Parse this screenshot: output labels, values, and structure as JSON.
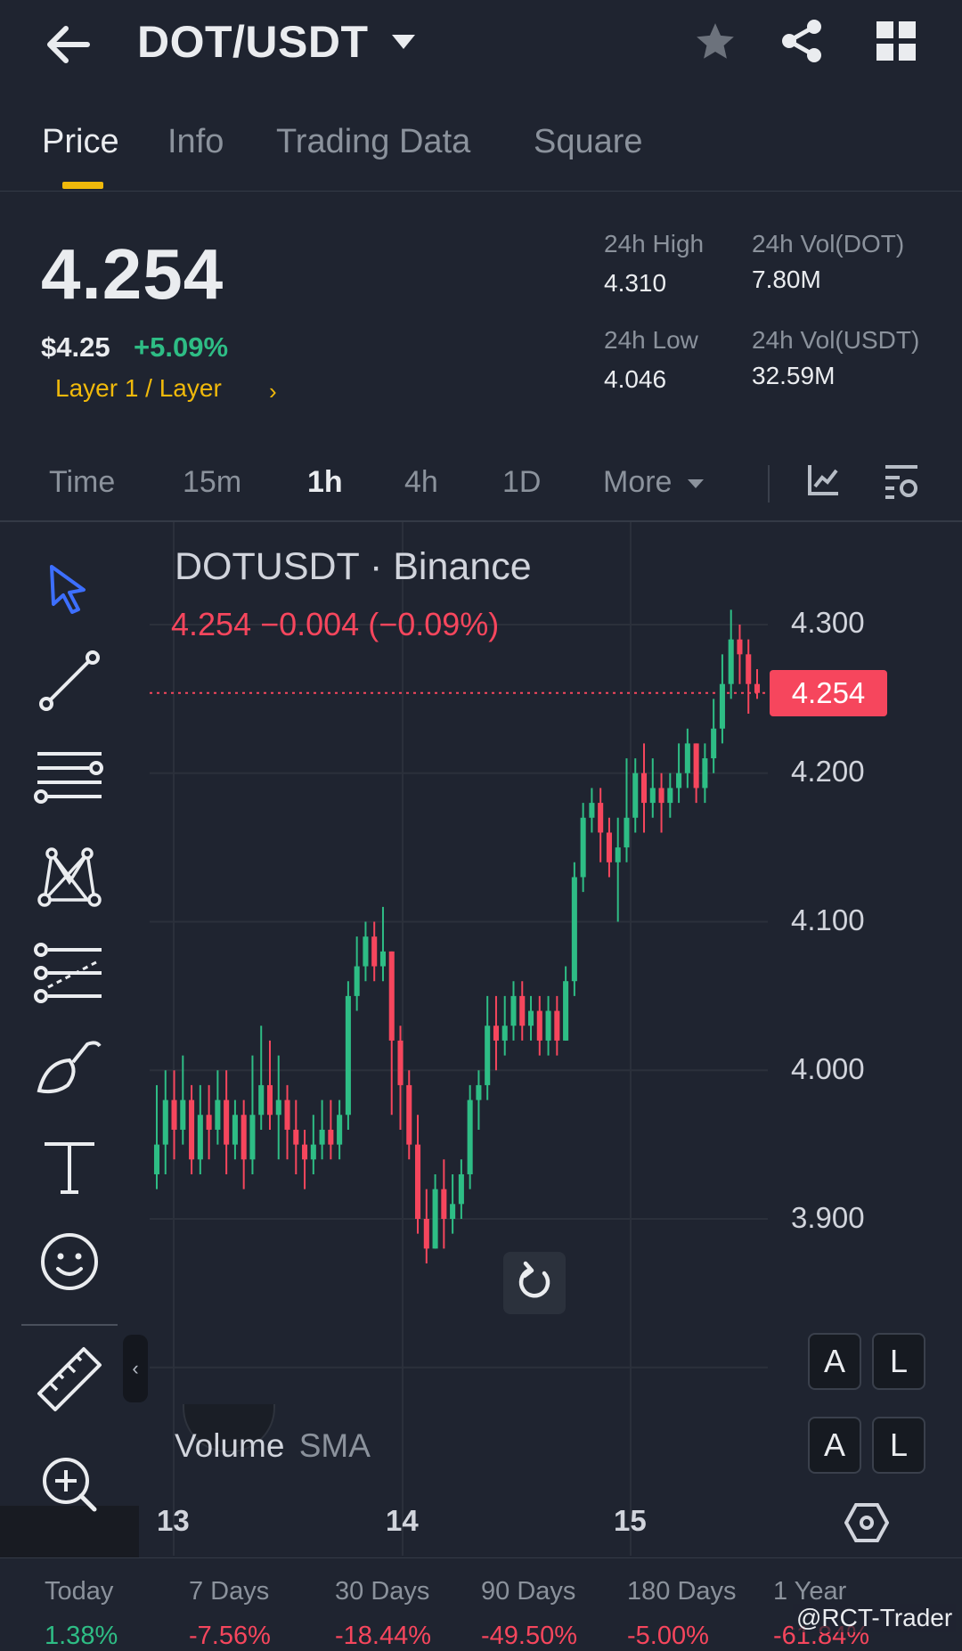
{
  "header": {
    "pair": "DOT/USDT"
  },
  "tabs": [
    "Price",
    "Info",
    "Trading Data",
    "Square"
  ],
  "price": {
    "last": "4.254",
    "usd": "$4.25",
    "change_pct": "+5.09%",
    "tag": "Layer 1 / Layer"
  },
  "stats": {
    "high_label": "24h High",
    "high_value": "4.310",
    "low_label": "24h Low",
    "low_value": "4.046",
    "vol_dot_label": "24h Vol(DOT)",
    "vol_dot_value": "7.80M",
    "vol_usdt_label": "24h Vol(USDT)",
    "vol_usdt_value": "32.59M"
  },
  "intervals": [
    "Time",
    "15m",
    "1h",
    "4h",
    "1D",
    "More"
  ],
  "active_interval": "1h",
  "chart": {
    "title": "DOTUSDT · Binance",
    "ohlc_line": "4.254  −0.004 (−0.09%)",
    "last_price_badge": "4.254",
    "volume_label": "Volume",
    "volume_indicator": "SMA",
    "auto_label": "A",
    "log_label": "L"
  },
  "colors": {
    "up": "#2ebd85",
    "down": "#f6465d",
    "accent": "#f0b90b",
    "background": "#1f2430"
  },
  "chart_data": {
    "type": "candlestick",
    "x_ticks": [
      "13",
      "14",
      "15"
    ],
    "y_ticks": [
      "4.300",
      "4.200",
      "4.100",
      "4.000",
      "3.900"
    ],
    "ylim": [
      3.86,
      4.32
    ],
    "last_price": 4.254,
    "candles": [
      [
        3.93,
        3.95,
        3.92,
        3.99
      ],
      [
        3.95,
        3.98,
        3.93,
        4.0
      ],
      [
        3.98,
        3.96,
        3.94,
        4.0
      ],
      [
        3.96,
        3.98,
        3.95,
        4.01
      ],
      [
        3.98,
        3.94,
        3.93,
        3.99
      ],
      [
        3.94,
        3.97,
        3.93,
        3.99
      ],
      [
        3.97,
        3.96,
        3.94,
        3.99
      ],
      [
        3.96,
        3.98,
        3.95,
        4.0
      ],
      [
        3.98,
        3.95,
        3.93,
        4.0
      ],
      [
        3.95,
        3.97,
        3.94,
        3.98
      ],
      [
        3.97,
        3.94,
        3.92,
        3.98
      ],
      [
        3.94,
        3.97,
        3.93,
        4.01
      ],
      [
        3.97,
        3.99,
        3.96,
        4.03
      ],
      [
        3.99,
        3.97,
        3.96,
        4.02
      ],
      [
        3.97,
        3.98,
        3.94,
        4.01
      ],
      [
        3.98,
        3.96,
        3.94,
        3.99
      ],
      [
        3.96,
        3.95,
        3.93,
        3.98
      ],
      [
        3.95,
        3.94,
        3.92,
        3.96
      ],
      [
        3.94,
        3.95,
        3.93,
        3.97
      ],
      [
        3.95,
        3.96,
        3.94,
        3.98
      ],
      [
        3.96,
        3.95,
        3.94,
        3.98
      ],
      [
        3.95,
        3.97,
        3.94,
        3.98
      ],
      [
        3.97,
        4.05,
        3.96,
        4.06
      ],
      [
        4.05,
        4.07,
        4.04,
        4.09
      ],
      [
        4.07,
        4.09,
        4.06,
        4.1
      ],
      [
        4.09,
        4.07,
        4.06,
        4.1
      ],
      [
        4.07,
        4.08,
        4.06,
        4.11
      ],
      [
        4.08,
        4.02,
        3.97,
        4.08
      ],
      [
        4.02,
        3.99,
        3.96,
        4.03
      ],
      [
        3.99,
        3.95,
        3.94,
        4.0
      ],
      [
        3.95,
        3.9,
        3.89,
        3.97
      ],
      [
        3.9,
        3.88,
        3.87,
        3.92
      ],
      [
        3.88,
        3.92,
        3.88,
        3.93
      ],
      [
        3.92,
        3.9,
        3.88,
        3.94
      ],
      [
        3.9,
        3.91,
        3.89,
        3.93
      ],
      [
        3.91,
        3.93,
        3.9,
        3.94
      ],
      [
        3.93,
        3.98,
        3.92,
        3.99
      ],
      [
        3.98,
        3.99,
        3.96,
        4.0
      ],
      [
        3.99,
        4.03,
        3.98,
        4.05
      ],
      [
        4.03,
        4.02,
        4.0,
        4.05
      ],
      [
        4.02,
        4.03,
        4.01,
        4.05
      ],
      [
        4.03,
        4.05,
        4.02,
        4.06
      ],
      [
        4.05,
        4.03,
        4.02,
        4.06
      ],
      [
        4.03,
        4.04,
        4.02,
        4.05
      ],
      [
        4.04,
        4.02,
        4.01,
        4.05
      ],
      [
        4.02,
        4.04,
        4.01,
        4.05
      ],
      [
        4.04,
        4.02,
        4.01,
        4.05
      ],
      [
        4.02,
        4.06,
        4.02,
        4.07
      ],
      [
        4.06,
        4.13,
        4.05,
        4.14
      ],
      [
        4.13,
        4.17,
        4.12,
        4.18
      ],
      [
        4.17,
        4.18,
        4.16,
        4.19
      ],
      [
        4.18,
        4.16,
        4.14,
        4.19
      ],
      [
        4.16,
        4.14,
        4.13,
        4.17
      ],
      [
        4.14,
        4.15,
        4.1,
        4.17
      ],
      [
        4.15,
        4.17,
        4.14,
        4.21
      ],
      [
        4.17,
        4.2,
        4.16,
        4.21
      ],
      [
        4.2,
        4.18,
        4.16,
        4.22
      ],
      [
        4.18,
        4.19,
        4.17,
        4.21
      ],
      [
        4.19,
        4.18,
        4.16,
        4.2
      ],
      [
        4.18,
        4.19,
        4.17,
        4.2
      ],
      [
        4.19,
        4.2,
        4.18,
        4.22
      ],
      [
        4.2,
        4.22,
        4.19,
        4.23
      ],
      [
        4.22,
        4.19,
        4.18,
        4.22
      ],
      [
        4.19,
        4.21,
        4.18,
        4.22
      ],
      [
        4.21,
        4.23,
        4.2,
        4.25
      ],
      [
        4.23,
        4.26,
        4.22,
        4.28
      ],
      [
        4.26,
        4.29,
        4.25,
        4.31
      ],
      [
        4.29,
        4.28,
        4.26,
        4.3
      ],
      [
        4.28,
        4.26,
        4.24,
        4.29
      ],
      [
        4.26,
        4.254,
        4.25,
        4.27
      ]
    ]
  },
  "performance": [
    {
      "label": "Today",
      "value": "1.38%",
      "dir": "up"
    },
    {
      "label": "7 Days",
      "value": "-7.56%",
      "dir": "down"
    },
    {
      "label": "30 Days",
      "value": "-18.44%",
      "dir": "down"
    },
    {
      "label": "90 Days",
      "value": "-49.50%",
      "dir": "down"
    },
    {
      "label": "180 Days",
      "value": "-5.00%",
      "dir": "down"
    },
    {
      "label": "1 Year",
      "value": "-61.84%",
      "dir": "down"
    }
  ],
  "watermark": "@RCT-Trader"
}
